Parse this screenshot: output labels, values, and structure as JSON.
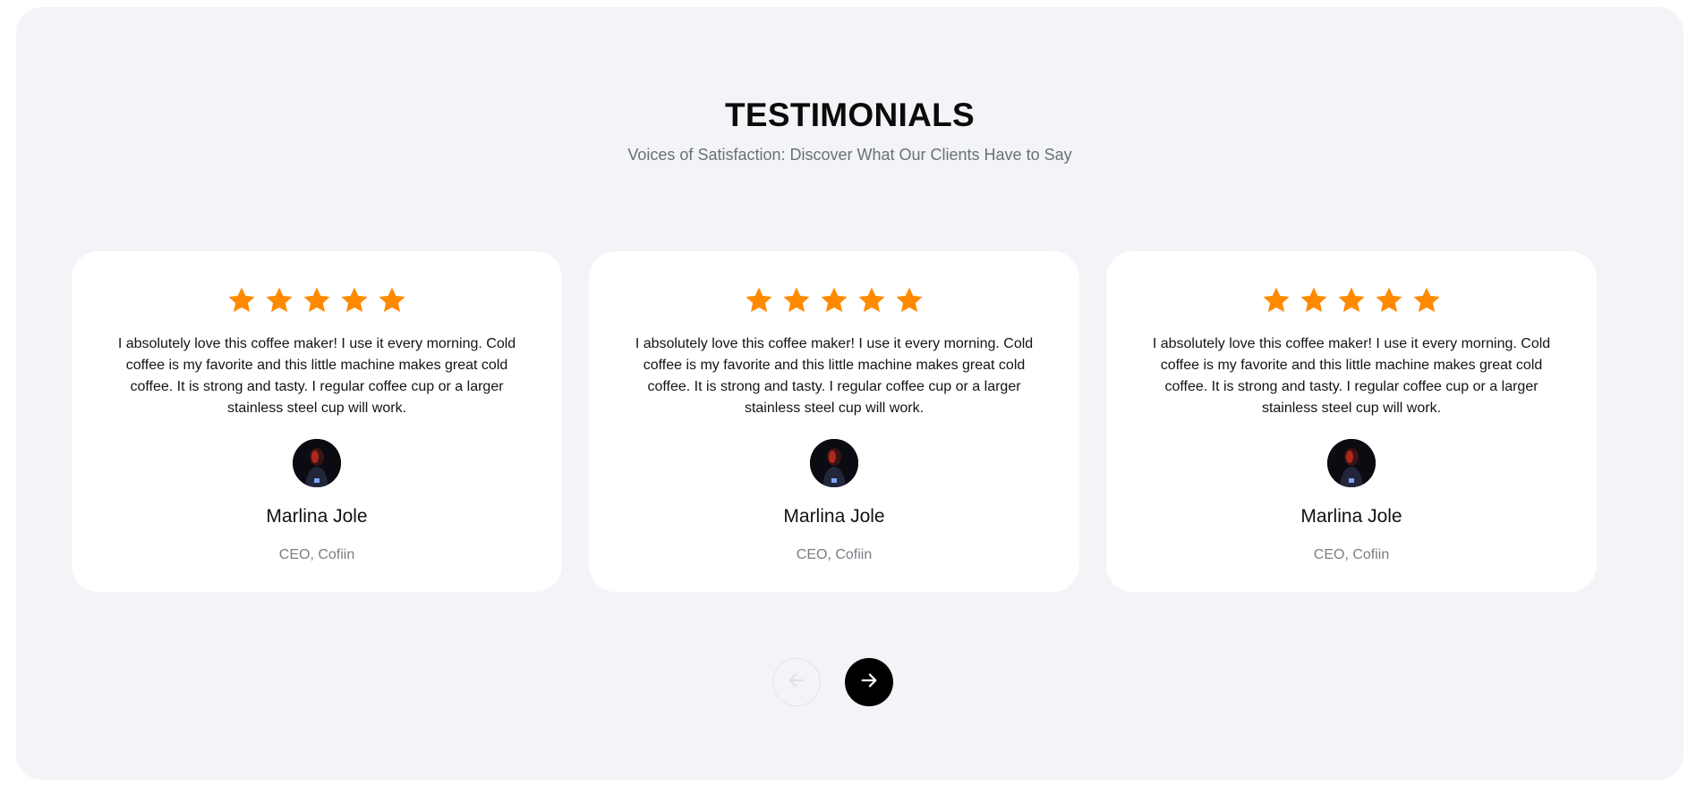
{
  "section": {
    "title": "TESTIMONIALS",
    "subtitle": "Voices of Satisfaction: Discover What Our Clients Have to Say"
  },
  "colors": {
    "star": "#ff8a00",
    "section_bg": "#f3f4f7",
    "card_bg": "#ffffff",
    "next_button": "#000000"
  },
  "testimonials": [
    {
      "rating": 5,
      "quote": "I absolutely love this coffee maker! I use it every morning. Cold coffee is my favorite and this little machine makes great cold coffee. It is strong and tasty. I regular coffee cup or a larger stainless steel cup will work.",
      "avatar_icon": "person-avatar",
      "name": "Marlina Jole",
      "role": "CEO, Cofiin"
    },
    {
      "rating": 5,
      "quote": "I absolutely love this coffee maker! I use it every morning. Cold coffee is my favorite and this little machine makes great cold coffee. It is strong and tasty. I regular coffee cup or a larger stainless steel cup will work.",
      "avatar_icon": "person-avatar",
      "name": "Marlina Jole",
      "role": "CEO, Cofiin"
    },
    {
      "rating": 5,
      "quote": "I absolutely love this coffee maker! I use it every morning. Cold coffee is my favorite and this little machine makes great cold coffee. It is strong and tasty. I regular coffee cup or a larger stainless steel cup will work.",
      "avatar_icon": "person-avatar",
      "name": "Marlina Jole",
      "role": "CEO, Cofiin"
    }
  ],
  "navigation": {
    "prev_icon": "arrow-left-icon",
    "next_icon": "arrow-right-icon",
    "prev_disabled": true
  }
}
